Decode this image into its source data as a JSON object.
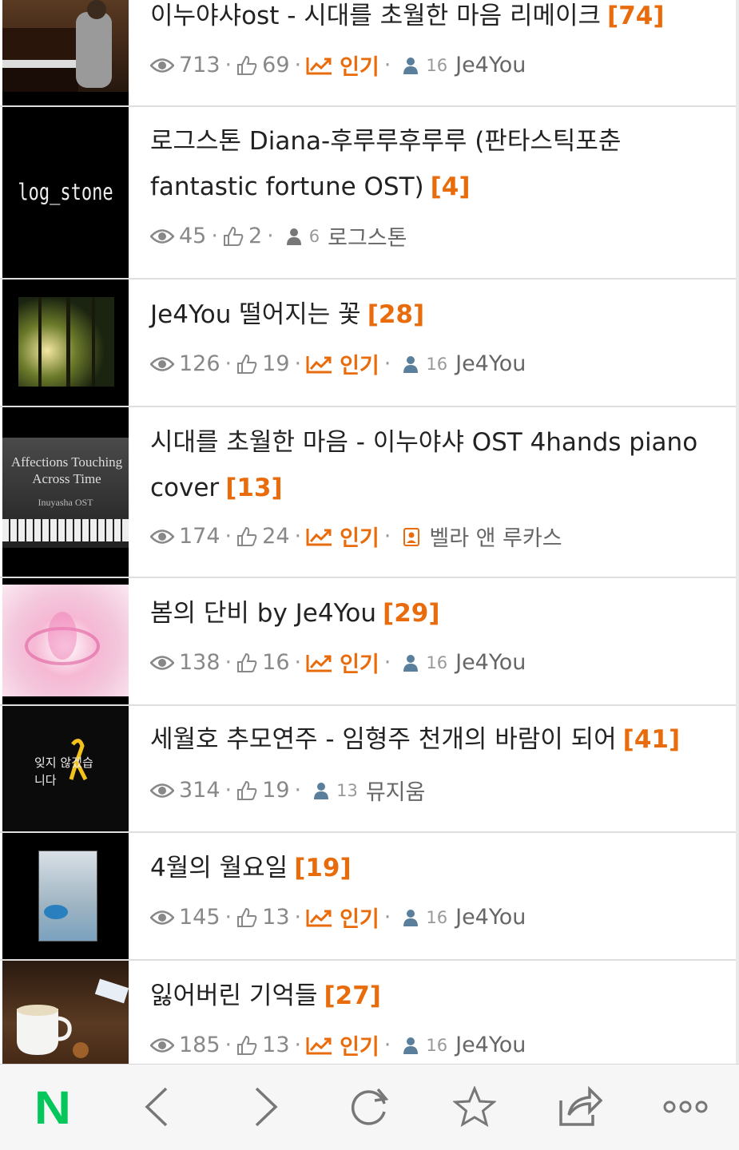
{
  "items": [
    {
      "title": "이누야샤ost - 시대를 초월한 마음 리메이크",
      "count": "[74]",
      "views": "713",
      "likes": "69",
      "hot": "인기",
      "level": "16",
      "author": "Je4You"
    },
    {
      "title": "로그스톤 Diana-후루루후루루 (판타스틱포춘 fantastic fortune OST)",
      "count": "[4]",
      "views": "45",
      "likes": "2",
      "level": "6",
      "author": "로그스톤",
      "thumb_text": "log_stone"
    },
    {
      "title": "Je4You 떨어지는 꽃",
      "count": "[28]",
      "views": "126",
      "likes": "19",
      "hot": "인기",
      "level": "16",
      "author": "Je4You"
    },
    {
      "title": "시대를 초월한 마음 - 이누야샤 OST 4hands piano cover",
      "count": "[13]",
      "views": "174",
      "likes": "24",
      "hot": "인기",
      "author": "벨라 앤 루카스",
      "thumb_text": "Affections Touching Across Time",
      "thumb_sub": "Inuyasha OST"
    },
    {
      "title": "봄의 단비 by Je4You",
      "count": "[29]",
      "views": "138",
      "likes": "16",
      "hot": "인기",
      "level": "16",
      "author": "Je4You"
    },
    {
      "title": "세월호 추모연주 - 임형주 천개의 바람이 되어",
      "count": "[41]",
      "views": "314",
      "likes": "19",
      "level": "13",
      "author": "뮤지움",
      "thumb_text": "잊지 않겠습니다"
    },
    {
      "title": "4월의 월요일",
      "count": "[19]",
      "views": "145",
      "likes": "13",
      "hot": "인기",
      "level": "16",
      "author": "Je4You"
    },
    {
      "title": "잃어버린 기억들",
      "count": "[27]",
      "views": "185",
      "likes": "13",
      "hot": "인기",
      "level": "16",
      "author": "Je4You"
    }
  ],
  "colors": {
    "accent": "#e96c0c",
    "naver_green": "#03c75a",
    "level_icon": "#5a7f9c"
  },
  "bottombar": {
    "logo": "N",
    "icons": [
      "back-icon",
      "forward-icon",
      "refresh-icon",
      "star-icon",
      "share-icon",
      "more-icon"
    ]
  }
}
